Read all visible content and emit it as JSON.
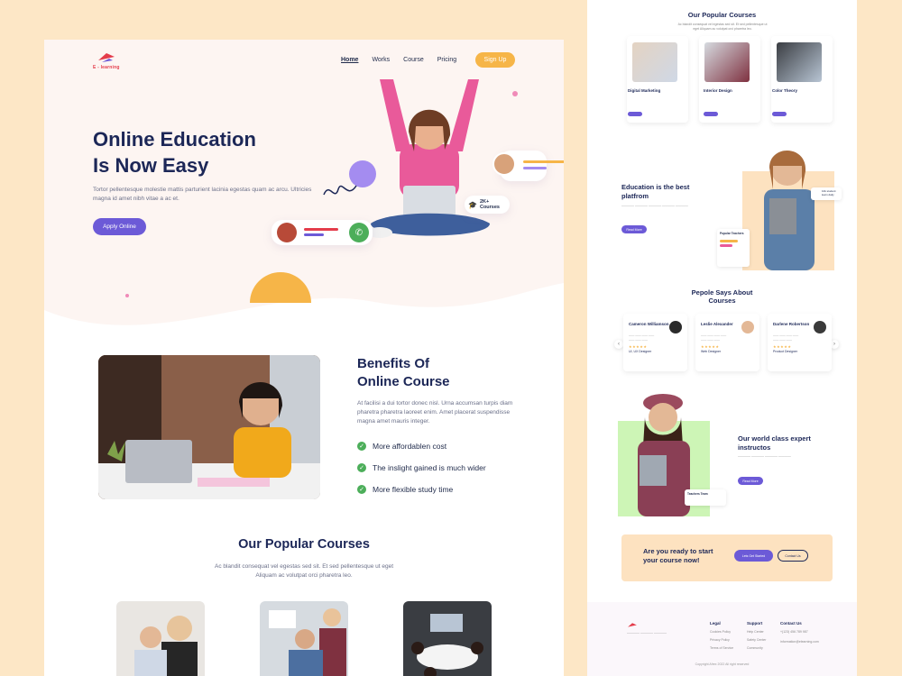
{
  "left": {
    "logo_text": "E - learning",
    "nav": [
      "Home",
      "Works",
      "Course",
      "Pricing"
    ],
    "signup": "Sign Up",
    "hero_title_1": "Online Education",
    "hero_title_2": "Is Now Easy",
    "hero_desc": "Tortor pellentesque molestie mattis parturient lacinia egestas quam ac arcu. Ultricies magna id amet nibh vitae a ac et.",
    "apply": "Apply Online",
    "courses_badge_1": "2K+",
    "courses_badge_2": "Courses",
    "benefit_title_1": "Benefits Of",
    "benefit_title_2": "Online Course",
    "benefit_desc": "At facilisi a dui tortor donec nisl. Urna accumsan turpis diam pharetra pharetra laoreet enim. Amet placerat suspendisse magna amet mauris integer.",
    "benefits": [
      "More affordablen cost",
      "The inslight gained is much wider",
      "More flexible study time"
    ],
    "popular_title": "Our Popular Courses",
    "popular_desc": "Ac blandit consequat vel egestas sed sit. Et sed pellentesque ut eget Aliquam ac volutpat orci pharetra leo."
  },
  "right": {
    "popular_title": "Our Popular Courses",
    "popular_desc": "Ac blandit consequat vel egestas sed sit. Et sed pellentesque ut eget Aliquam ac volutpat orci pharetra leo.",
    "courses": [
      "Digital Marketing",
      "Interior Design",
      "Color Theory"
    ],
    "edu_title_1": "Education is the best",
    "edu_title_2": "platfrom",
    "read_more": "Read More",
    "popular_teachers": "Popular Teachers",
    "students_badge": "10k student learn daily",
    "testi_title_1": "Pepole Says About",
    "testi_title_2": "Courses",
    "testimonials": [
      {
        "name": "Cameron Williamson",
        "role": "UI, UX Designer"
      },
      {
        "name": "Leslie Alexander",
        "role": "Web Designer"
      },
      {
        "name": "Darlene Robertson",
        "role": "Product Designer"
      }
    ],
    "expert_title_1": "Our world class expert",
    "expert_title_2": "instructos",
    "teachers_team": "Teachers Team",
    "cta_1": "Are you ready to start",
    "cta_2": "your course now!",
    "cta_btn1": "Lets Get Started",
    "cta_btn2": "Contact Us",
    "footer_cols": [
      "Legal",
      "Support",
      "Contact Us"
    ],
    "legal_items": [
      "Cookies Policy",
      "Privacy Policy",
      "Terms of Service"
    ],
    "support_items": [
      "Help Center",
      "Safety Center",
      "Community"
    ],
    "contact_items": [
      "+(123) 456 789 987",
      "information@elearning.com"
    ],
    "copyright": "Copyright Afrex 2022 All right reserved"
  },
  "colors": {
    "primary": "#6c5ad7",
    "accent": "#f6b548",
    "bg": "#fde7c6",
    "navy": "#1c2757",
    "green": "#4cae5a"
  }
}
